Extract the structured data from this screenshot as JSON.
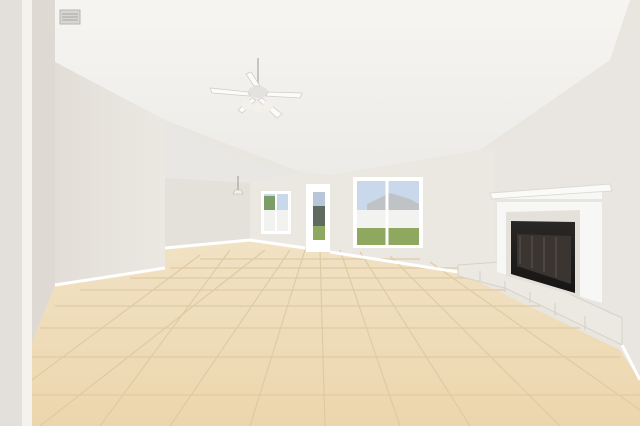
{
  "scene": {
    "kind": "photo",
    "colors": {
      "wall": "#ebe8e3",
      "wall_shadow": "#dcd8d1",
      "ceiling": "#f1efeb",
      "floor": "#efdcb8",
      "floor_grout": "#ddc7a1",
      "baseboard": "#ffffff",
      "fireplace_surround": "#f7f7f5",
      "hearth_tile": "#e6e3dc",
      "firebox": "#1f1d1b",
      "window_sky": "#c9d8ea",
      "window_grass": "#8ea860",
      "window_fence": "#f2f2f0",
      "fan_blade": "#fbfbfa",
      "fan_metal": "#c7c5c1"
    },
    "objects": [
      "vaulted-ceiling",
      "ceiling-fan-icon",
      "pendant-light-icon",
      "ceiling-vent-icon",
      "window-left",
      "patio-door",
      "window-right",
      "fireplace",
      "tile-floor",
      "open-doorway"
    ]
  }
}
